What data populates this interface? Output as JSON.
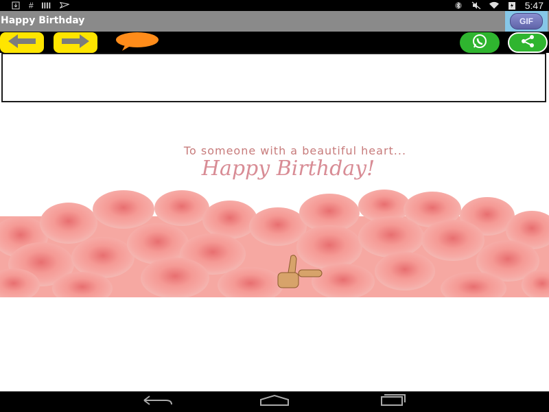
{
  "status_bar": {
    "hash_symbol": "#",
    "time": "5:47",
    "icons": [
      "download-icon",
      "hash-icon",
      "barcode-icon",
      "send-icon",
      "bluetooth-icon",
      "mute-icon",
      "wifi-icon",
      "battery-icon"
    ]
  },
  "app_bar": {
    "title": "Happy Birthday",
    "gif_button_label": "GIF"
  },
  "toolbar": {
    "icons": [
      "arrow-left-icon",
      "arrow-right-icon",
      "speech-bubble-icon",
      "whatsapp-icon",
      "share-icon"
    ]
  },
  "message_box": {
    "value": ""
  },
  "card": {
    "line1": "To someone with a beautiful heart...",
    "line2": "Happy Birthday!"
  },
  "nav_bar": {
    "icons": [
      "back-icon",
      "home-icon",
      "recents-icon"
    ]
  },
  "colors": {
    "status_bar_bg": "#000000",
    "app_bar_bg": "#8a8a8a",
    "arrow_button": "#ffe500",
    "bubble": "#ff8c1a",
    "whatsapp": "#2fb52f",
    "rose": "#f28a86",
    "card_text": "#c77b7b"
  }
}
